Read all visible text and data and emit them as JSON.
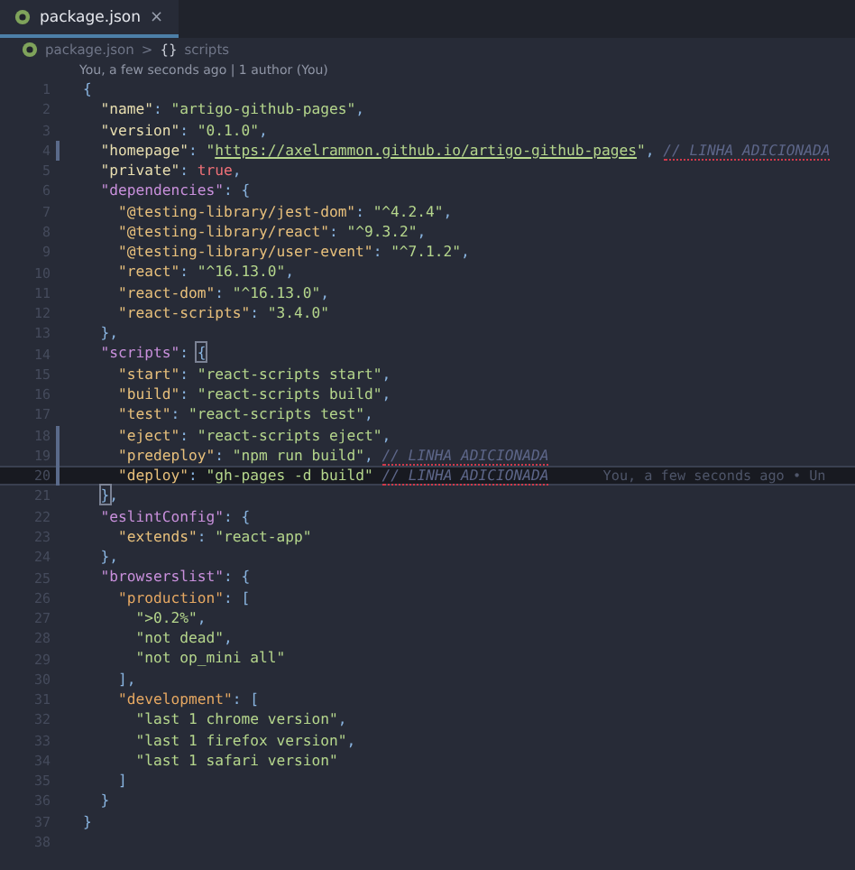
{
  "tabs": [
    {
      "label": "package.json",
      "close": "×",
      "selected": true
    }
  ],
  "breadcrumb": {
    "file": "package.json",
    "separator": ">",
    "symbol": "{}",
    "item": "scripts"
  },
  "codelens": "You, a few seconds ago | 1 author (You)",
  "lines": [
    {
      "number": "1",
      "changed": false,
      "current": false,
      "tokens": [
        {
          "kind": "punct",
          "text": "{"
        }
      ]
    },
    {
      "number": "2",
      "changed": false,
      "current": false,
      "tokens": [
        {
          "kind": "key",
          "text": "  \"name\""
        },
        {
          "kind": "punct",
          "text": ": "
        },
        {
          "kind": "string",
          "text": "\"artigo-github-pages\""
        },
        {
          "kind": "punct",
          "text": ","
        }
      ]
    },
    {
      "number": "3",
      "changed": false,
      "current": false,
      "tokens": [
        {
          "kind": "key",
          "text": "  \"version\""
        },
        {
          "kind": "punct",
          "text": ": "
        },
        {
          "kind": "string",
          "text": "\"0.1.0\""
        },
        {
          "kind": "punct",
          "text": ","
        }
      ]
    },
    {
      "number": "4",
      "changed": true,
      "current": false,
      "tokens": [
        {
          "kind": "key",
          "text": "  \"homepage\""
        },
        {
          "kind": "punct",
          "text": ": "
        },
        {
          "kind": "string",
          "text": "\""
        },
        {
          "kind": "link",
          "text": "https://axelrammon.github.io/artigo-github-pages"
        },
        {
          "kind": "string",
          "text": "\""
        },
        {
          "kind": "punct",
          "text": ", "
        },
        {
          "kind": "comment",
          "text": "// LINHA ADICIONADA",
          "warning": true
        }
      ]
    },
    {
      "number": "5",
      "changed": false,
      "current": false,
      "tokens": [
        {
          "kind": "key",
          "text": "  \"private\""
        },
        {
          "kind": "punct",
          "text": ": "
        },
        {
          "kind": "boolean",
          "text": "true"
        },
        {
          "kind": "punct",
          "text": ","
        }
      ]
    },
    {
      "number": "6",
      "changed": false,
      "current": false,
      "tokens": [
        {
          "kind": "object-key",
          "text": "  \"dependencies\""
        },
        {
          "kind": "punct",
          "text": ": {"
        }
      ]
    },
    {
      "number": "7",
      "changed": false,
      "current": false,
      "tokens": [
        {
          "kind": "inner-key",
          "text": "    \"@testing-library/jest-dom\""
        },
        {
          "kind": "punct",
          "text": ": "
        },
        {
          "kind": "string",
          "text": "\"^4.2.4\""
        },
        {
          "kind": "punct",
          "text": ","
        }
      ]
    },
    {
      "number": "8",
      "changed": false,
      "current": false,
      "tokens": [
        {
          "kind": "inner-key",
          "text": "    \"@testing-library/react\""
        },
        {
          "kind": "punct",
          "text": ": "
        },
        {
          "kind": "string",
          "text": "\"^9.3.2\""
        },
        {
          "kind": "punct",
          "text": ","
        }
      ]
    },
    {
      "number": "9",
      "changed": false,
      "current": false,
      "tokens": [
        {
          "kind": "inner-key",
          "text": "    \"@testing-library/user-event\""
        },
        {
          "kind": "punct",
          "text": ": "
        },
        {
          "kind": "string",
          "text": "\"^7.1.2\""
        },
        {
          "kind": "punct",
          "text": ","
        }
      ]
    },
    {
      "number": "10",
      "changed": false,
      "current": false,
      "tokens": [
        {
          "kind": "inner-key",
          "text": "    \"react\""
        },
        {
          "kind": "punct",
          "text": ": "
        },
        {
          "kind": "string",
          "text": "\"^16.13.0\""
        },
        {
          "kind": "punct",
          "text": ","
        }
      ]
    },
    {
      "number": "11",
      "changed": false,
      "current": false,
      "tokens": [
        {
          "kind": "inner-key",
          "text": "    \"react-dom\""
        },
        {
          "kind": "punct",
          "text": ": "
        },
        {
          "kind": "string",
          "text": "\"^16.13.0\""
        },
        {
          "kind": "punct",
          "text": ","
        }
      ]
    },
    {
      "number": "12",
      "changed": false,
      "current": false,
      "tokens": [
        {
          "kind": "inner-key",
          "text": "    \"react-scripts\""
        },
        {
          "kind": "punct",
          "text": ": "
        },
        {
          "kind": "string",
          "text": "\"3.4.0\""
        }
      ]
    },
    {
      "number": "13",
      "changed": false,
      "current": false,
      "tokens": [
        {
          "kind": "punct",
          "text": "  },"
        }
      ]
    },
    {
      "number": "14",
      "changed": false,
      "current": false,
      "tokens": [
        {
          "kind": "object-key",
          "text": "  \"scripts\""
        },
        {
          "kind": "punct",
          "text": ": "
        },
        {
          "kind": "punct",
          "text": "{",
          "matched": true
        }
      ]
    },
    {
      "number": "15",
      "changed": false,
      "current": false,
      "tokens": [
        {
          "kind": "inner-key",
          "text": "    \"start\""
        },
        {
          "kind": "punct",
          "text": ": "
        },
        {
          "kind": "string",
          "text": "\"react-scripts start\""
        },
        {
          "kind": "punct",
          "text": ","
        }
      ]
    },
    {
      "number": "16",
      "changed": false,
      "current": false,
      "tokens": [
        {
          "kind": "inner-key",
          "text": "    \"build\""
        },
        {
          "kind": "punct",
          "text": ": "
        },
        {
          "kind": "string",
          "text": "\"react-scripts build\""
        },
        {
          "kind": "punct",
          "text": ","
        }
      ]
    },
    {
      "number": "17",
      "changed": false,
      "current": false,
      "tokens": [
        {
          "kind": "inner-key",
          "text": "    \"test\""
        },
        {
          "kind": "punct",
          "text": ": "
        },
        {
          "kind": "string",
          "text": "\"react-scripts test\""
        },
        {
          "kind": "punct",
          "text": ","
        }
      ]
    },
    {
      "number": "18",
      "changed": true,
      "current": false,
      "tokens": [
        {
          "kind": "inner-key",
          "text": "    \"eject\""
        },
        {
          "kind": "punct",
          "text": ": "
        },
        {
          "kind": "string",
          "text": "\"react-scripts eject\""
        },
        {
          "kind": "punct",
          "text": ","
        }
      ]
    },
    {
      "number": "19",
      "changed": true,
      "current": false,
      "tokens": [
        {
          "kind": "inner-key",
          "text": "    \"predeploy\""
        },
        {
          "kind": "punct",
          "text": ": "
        },
        {
          "kind": "string",
          "text": "\"npm run build\""
        },
        {
          "kind": "punct",
          "text": ", "
        },
        {
          "kind": "comment",
          "text": "// LINHA ADICIONADA",
          "warning": true
        }
      ]
    },
    {
      "number": "20",
      "changed": true,
      "current": true,
      "blame": "You, a few seconds ago • Un",
      "tokens": [
        {
          "kind": "inner-key",
          "text": "    \"deploy\""
        },
        {
          "kind": "punct",
          "text": ": "
        },
        {
          "kind": "string",
          "text": "\"gh-pages -d build\" "
        },
        {
          "kind": "comment",
          "text": "// LINHA ADICIONADA",
          "warning": true
        }
      ]
    },
    {
      "number": "21",
      "changed": false,
      "current": false,
      "tokens": [
        {
          "kind": "punct",
          "text": "  }",
          "matched": true
        },
        {
          "kind": "punct",
          "text": ","
        }
      ]
    },
    {
      "number": "22",
      "changed": false,
      "current": false,
      "tokens": [
        {
          "kind": "object-key",
          "text": "  \"eslintConfig\""
        },
        {
          "kind": "punct",
          "text": ": {"
        }
      ]
    },
    {
      "number": "23",
      "changed": false,
      "current": false,
      "tokens": [
        {
          "kind": "inner-key",
          "text": "    \"extends\""
        },
        {
          "kind": "punct",
          "text": ": "
        },
        {
          "kind": "string",
          "text": "\"react-app\""
        }
      ]
    },
    {
      "number": "24",
      "changed": false,
      "current": false,
      "tokens": [
        {
          "kind": "punct",
          "text": "  },"
        }
      ]
    },
    {
      "number": "25",
      "changed": false,
      "current": false,
      "tokens": [
        {
          "kind": "object-key",
          "text": "  \"browserslist\""
        },
        {
          "kind": "punct",
          "text": ": {"
        }
      ]
    },
    {
      "number": "26",
      "changed": false,
      "current": false,
      "tokens": [
        {
          "kind": "list-key",
          "text": "    \"production\""
        },
        {
          "kind": "punct",
          "text": ": ["
        }
      ]
    },
    {
      "number": "27",
      "changed": false,
      "current": false,
      "tokens": [
        {
          "kind": "string",
          "text": "      \">0.2%\""
        },
        {
          "kind": "punct",
          "text": ","
        }
      ]
    },
    {
      "number": "28",
      "changed": false,
      "current": false,
      "tokens": [
        {
          "kind": "string",
          "text": "      \"not dead\""
        },
        {
          "kind": "punct",
          "text": ","
        }
      ]
    },
    {
      "number": "29",
      "changed": false,
      "current": false,
      "tokens": [
        {
          "kind": "string",
          "text": "      \"not op_mini all\""
        }
      ]
    },
    {
      "number": "30",
      "changed": false,
      "current": false,
      "tokens": [
        {
          "kind": "punct",
          "text": "    ],"
        }
      ]
    },
    {
      "number": "31",
      "changed": false,
      "current": false,
      "tokens": [
        {
          "kind": "list-key",
          "text": "    \"development\""
        },
        {
          "kind": "punct",
          "text": ": ["
        }
      ]
    },
    {
      "number": "32",
      "changed": false,
      "current": false,
      "tokens": [
        {
          "kind": "string",
          "text": "      \"last 1 chrome version\""
        },
        {
          "kind": "punct",
          "text": ","
        }
      ]
    },
    {
      "number": "33",
      "changed": false,
      "current": false,
      "tokens": [
        {
          "kind": "string",
          "text": "      \"last 1 firefox version\""
        },
        {
          "kind": "punct",
          "text": ","
        }
      ]
    },
    {
      "number": "34",
      "changed": false,
      "current": false,
      "tokens": [
        {
          "kind": "string",
          "text": "      \"last 1 safari version\""
        }
      ]
    },
    {
      "number": "35",
      "changed": false,
      "current": false,
      "tokens": [
        {
          "kind": "punct",
          "text": "    ]"
        }
      ]
    },
    {
      "number": "36",
      "changed": false,
      "current": false,
      "tokens": [
        {
          "kind": "punct",
          "text": "  }"
        }
      ]
    },
    {
      "number": "37",
      "changed": false,
      "current": false,
      "tokens": [
        {
          "kind": "punct",
          "text": "}"
        }
      ]
    },
    {
      "number": "38",
      "changed": false,
      "current": false
    }
  ]
}
